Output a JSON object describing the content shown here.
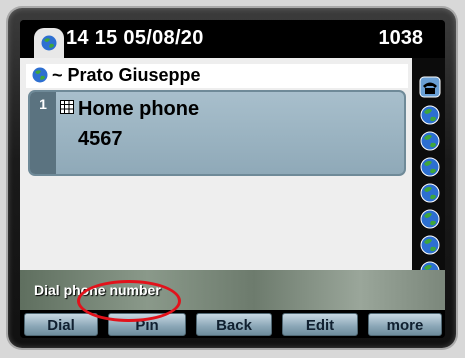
{
  "status_bar": {
    "datetime": "14 15 05/08/20",
    "extension": "1038"
  },
  "contact": {
    "name": "~ Prato Giuseppe",
    "entries": [
      {
        "index": "1",
        "label": "Home phone",
        "number": "4567"
      }
    ]
  },
  "prompt": "Dial phone number",
  "softkeys": [
    {
      "label": "Dial"
    },
    {
      "label": "Pin"
    },
    {
      "label": "Back"
    },
    {
      "label": "Edit"
    },
    {
      "label": "more"
    }
  ],
  "colors": {
    "highlight": "#e2121b",
    "softkey": "#8aa6b6",
    "entry": "#9db5c3"
  },
  "icons": {
    "status_tab": "globe-icon",
    "contact": "globe-icon",
    "entry_type": "phone-grid-icon",
    "rail_top": "telephone-icon",
    "rail_lines": "globe-icon"
  }
}
